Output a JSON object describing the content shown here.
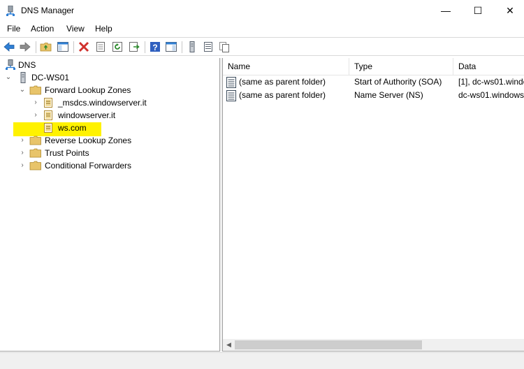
{
  "window": {
    "title": "DNS Manager",
    "minimize_glyph": "—",
    "maximize_glyph": "☐",
    "close_glyph": "✕"
  },
  "menu": [
    "File",
    "Action",
    "View",
    "Help"
  ],
  "toolbar": {
    "icons": [
      "back-arrow-icon",
      "forward-arrow-icon",
      "up-folder-icon",
      "show-hide-console-tree-icon",
      "delete-icon",
      "properties-icon",
      "refresh-icon",
      "export-list-icon",
      "help-icon",
      "show-action-pane-icon",
      "server-icon",
      "list-icon",
      "copy-icon"
    ]
  },
  "tree": {
    "root": "DNS",
    "server": "DC-WS01",
    "forward_lookup_zones": "Forward Lookup Zones",
    "zones": [
      "_msdcs.windowserver.it",
      "windowserver.it",
      "ws.com"
    ],
    "reverse_lookup_zones": "Reverse Lookup Zones",
    "trust_points": "Trust Points",
    "conditional_forwarders": "Conditional Forwarders",
    "selected_zone": "ws.com"
  },
  "list": {
    "columns": [
      "Name",
      "Type",
      "Data"
    ],
    "rows": [
      {
        "name": "(same as parent folder)",
        "type": "Start of Authority (SOA)",
        "data": "[1], dc-ws01.windo"
      },
      {
        "name": "(same as parent folder)",
        "type": "Name Server (NS)",
        "data": "dc-ws01.windows"
      }
    ]
  },
  "colors": {
    "highlight": "#fff200",
    "folder": "#e8c46a",
    "back_arrow": "#2f7fd4",
    "delete": "#d0312d"
  }
}
